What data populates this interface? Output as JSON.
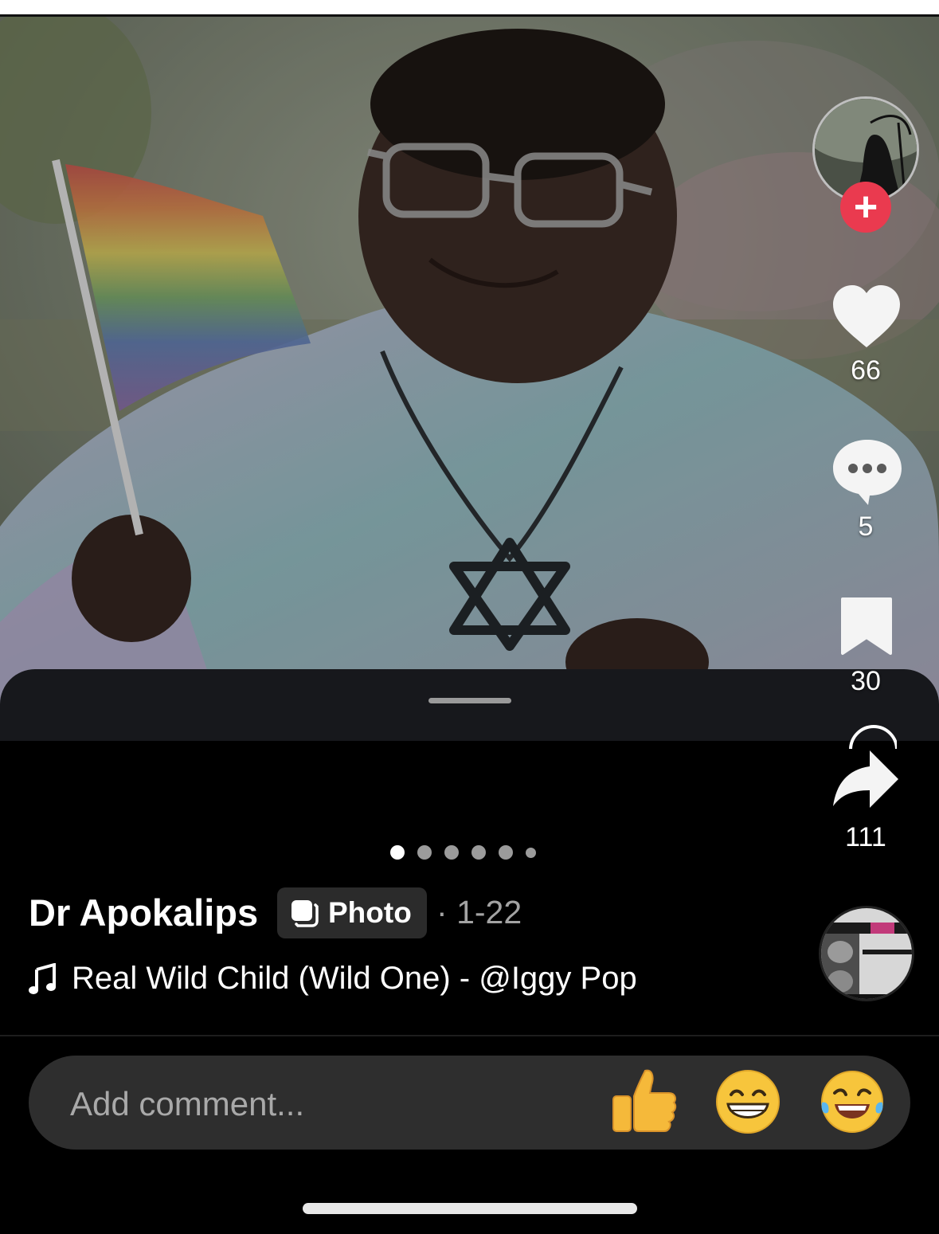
{
  "post": {
    "author": "Dr Apokalips",
    "type_badge": "Photo",
    "date_separator": "·",
    "date": "1-22"
  },
  "music": {
    "title": "Real Wild Child (Wild One) - @Iggy Pop",
    "icon": "music-note-icon"
  },
  "actions": {
    "likes": "66",
    "comments": "5",
    "bookmarks": "30",
    "shares": "111",
    "follow_icon": "plus-icon"
  },
  "pager": {
    "total": 6,
    "active_index": 0
  },
  "comment": {
    "placeholder": "Add comment...",
    "quick_emojis": [
      "👍",
      "😁",
      "😂"
    ]
  },
  "colors": {
    "follow": "#ea3a4f",
    "badge_bg": "#2b2b2b",
    "comment_bar": "#2e2e2e",
    "date": "#a3a3a3"
  }
}
